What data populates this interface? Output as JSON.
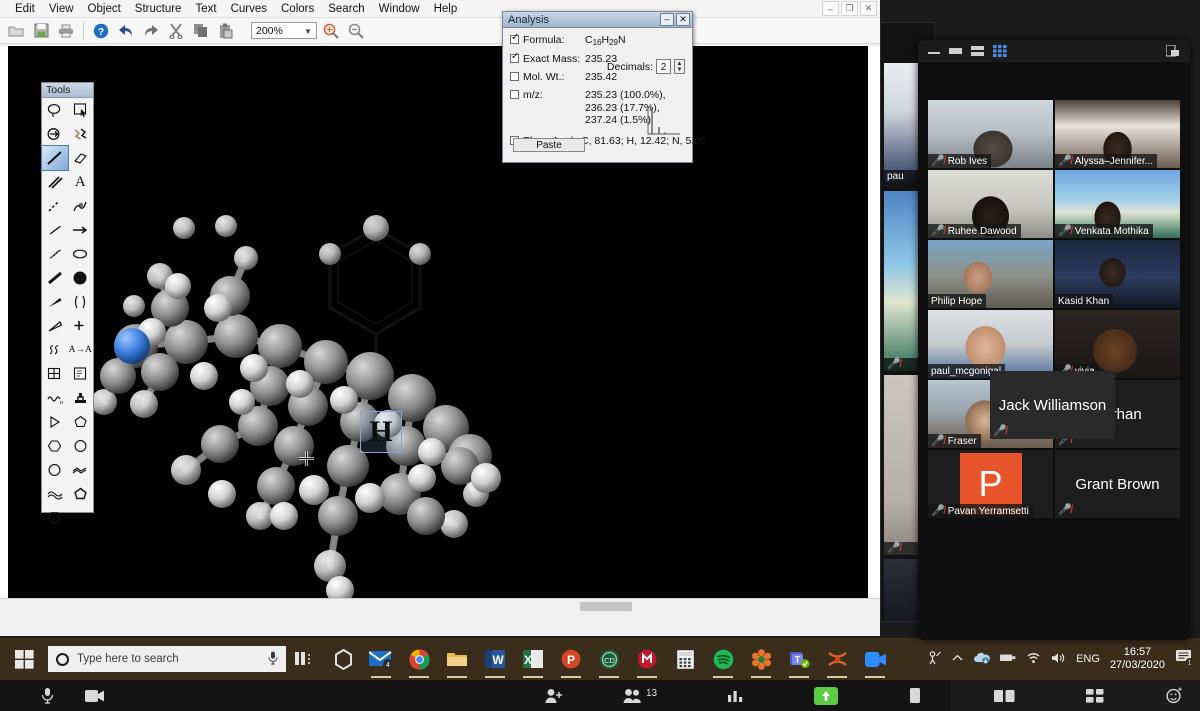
{
  "chemdraw": {
    "menus": [
      "Edit",
      "View",
      "Object",
      "Structure",
      "Text",
      "Curves",
      "Colors",
      "Search",
      "Window",
      "Help"
    ],
    "window_controls": [
      "–",
      "❐",
      "✕"
    ],
    "toolbar": {
      "zoom_value": "200%",
      "buttons": [
        {
          "name": "open-icon",
          "glyph": "▱"
        },
        {
          "name": "save-icon",
          "glyph": "▤"
        },
        {
          "name": "print-icon",
          "glyph": "🖶"
        },
        {
          "name": "help-icon",
          "glyph": "?"
        },
        {
          "name": "undo-icon",
          "glyph": "↰"
        },
        {
          "name": "redo-icon",
          "glyph": "↱"
        },
        {
          "name": "cut-icon",
          "glyph": "✂"
        },
        {
          "name": "copy-icon",
          "glyph": "❐"
        },
        {
          "name": "paste-icon",
          "glyph": "📋"
        }
      ],
      "zoom_in": "⊕",
      "zoom_out": "⊖"
    },
    "tools_palette": {
      "title": "Tools",
      "items": [
        {
          "name": "lasso-tool",
          "glyph": "◯"
        },
        {
          "name": "marquee-select-tool",
          "glyph": "⬔"
        },
        {
          "name": "eraser-pointer-tool",
          "glyph": "⊕"
        },
        {
          "name": "chain-tool",
          "glyph": "⌁"
        },
        {
          "name": "solid-bond-tool",
          "glyph": "╱",
          "selected": true
        },
        {
          "name": "eraser-tool",
          "glyph": "▱"
        },
        {
          "name": "multiple-bond-tool",
          "glyph": "⫽"
        },
        {
          "name": "text-tool",
          "glyph": "A"
        },
        {
          "name": "dashed-bond-tool",
          "glyph": "⁄"
        },
        {
          "name": "pen-tool",
          "glyph": "✎"
        },
        {
          "name": "hashed-bond-tool",
          "glyph": "⫼"
        },
        {
          "name": "arrow-tool",
          "glyph": "→"
        },
        {
          "name": "hashed-wedge-tool",
          "glyph": "⫼"
        },
        {
          "name": "orbital-tool",
          "glyph": "⬭"
        },
        {
          "name": "bold-bond-tool",
          "glyph": "╲"
        },
        {
          "name": "filled-circle-tool",
          "glyph": "●"
        },
        {
          "name": "wedge-bond-tool",
          "glyph": "◣"
        },
        {
          "name": "bracket-tool",
          "glyph": "()"
        },
        {
          "name": "hollow-wedge-tool",
          "glyph": "◺"
        },
        {
          "name": "plus-tool",
          "glyph": "+"
        },
        {
          "name": "squiggle-bond-tool",
          "glyph": "ʓ"
        },
        {
          "name": "atom-label-tool",
          "glyph": "A→A"
        },
        {
          "name": "table-tool",
          "glyph": "⊞"
        },
        {
          "name": "template-tool",
          "glyph": "🗒"
        },
        {
          "name": "polymer-bracket-tool",
          "glyph": "∿"
        },
        {
          "name": "stamp-tool",
          "glyph": "⌷"
        },
        {
          "name": "triangle-tool",
          "glyph": "▷"
        },
        {
          "name": "cyclopentane-tool",
          "glyph": "⬠"
        },
        {
          "name": "cyclohexane-tool",
          "glyph": "⬡"
        },
        {
          "name": "cyclopentane-ring-tool",
          "glyph": "○"
        },
        {
          "name": "cyclohexane-ring-tool",
          "glyph": "⬡"
        },
        {
          "name": "chair-tool",
          "glyph": "∽"
        },
        {
          "name": "chair-alt-tool",
          "glyph": "≈"
        },
        {
          "name": "cyclopentane-filled-tool",
          "glyph": "⬟"
        },
        {
          "name": "cyclohexane-filled-tool",
          "glyph": "⬢"
        }
      ]
    },
    "selected_atom_label": "H"
  },
  "analysis_dialog": {
    "title": "Analysis",
    "minimize": "–",
    "close": "✕",
    "rows": [
      {
        "name": "formula",
        "checked": true,
        "label": "Formula:",
        "value_html": "C16H29N",
        "value": "C16H29N"
      },
      {
        "name": "exact-mass",
        "checked": true,
        "label": "Exact Mass:",
        "value": "235.23"
      },
      {
        "name": "mol-weight",
        "checked": false,
        "label": "Mol. Wt.:",
        "value": "235.42"
      },
      {
        "name": "mz",
        "checked": false,
        "label": "m/z:",
        "value": "235.23 (100.0%), 236.23 (17.7%), 237.24 (1.5%)"
      },
      {
        "name": "elem-anal",
        "checked": false,
        "label": "Elem. Anal.:",
        "value": "C, 81.63; H, 12.42; N, 5.95"
      }
    ],
    "mz_lines": [
      "235.23 (100.0%),",
      "236.23 (17.7%),",
      "237.24 (1.5%)"
    ],
    "decimals_label": "Decimals:",
    "decimals_value": "2",
    "paste_label": "Paste"
  },
  "zoom_meeting": {
    "toolbar_icons": [
      {
        "name": "minimize-icon",
        "glyph": "—"
      },
      {
        "name": "maximize-icon",
        "glyph": "▬"
      },
      {
        "name": "speaker-view-icon",
        "glyph": "▤"
      },
      {
        "name": "gallery-view-icon",
        "glyph": "▦"
      }
    ],
    "fullscreen_icon": "⛶",
    "participants": [
      {
        "name": "Rob Ives",
        "muted": true,
        "video": true,
        "avatar": null,
        "photo": "p-rob",
        "active": false
      },
      {
        "name": "Alyssa–Jennifer...",
        "muted": true,
        "video": true,
        "photo": "p-alys",
        "active": false
      },
      {
        "name": "Ruhee Dawood",
        "muted": true,
        "video": true,
        "photo": "p-ruhee",
        "active": false
      },
      {
        "name": "Venkata Mothika",
        "muted": true,
        "video": true,
        "photo": "p-venk",
        "active": false
      },
      {
        "name": "Philip Hope",
        "muted": false,
        "video": true,
        "photo": "p-phil",
        "active": false
      },
      {
        "name": "Kasid Khan",
        "muted": false,
        "video": true,
        "photo": "p-kasid",
        "active": false
      },
      {
        "name": "paul_mcgonigal",
        "muted": false,
        "video": true,
        "photo": "p-paul",
        "active": true
      },
      {
        "name": "vivia",
        "muted": true,
        "video": true,
        "photo": "p-vivia",
        "active": false
      },
      {
        "name": "Fraser",
        "muted": true,
        "video": true,
        "photo": "p-fras",
        "active": false
      },
      {
        "name": "Burhan",
        "muted": true,
        "video": false,
        "photo": null,
        "active": false
      },
      {
        "name": "Pavan Yerramsetti",
        "muted": true,
        "video": false,
        "avatar": "P",
        "active": false
      },
      {
        "name": "Grant Brown",
        "muted": true,
        "video": false,
        "photo": null,
        "active": false
      },
      {
        "name": "Jack Williamson",
        "muted": true,
        "video": false,
        "photo": null,
        "active": false
      }
    ],
    "background_window_names": [
      "pau",
      "",
      ""
    ],
    "control_bar": {
      "participant_count": "13",
      "items": [
        {
          "name": "mute-control",
          "glyph": "🎤"
        },
        {
          "name": "video-control",
          "glyph": "📹"
        },
        {
          "name": "invite-control",
          "glyph": "👤+"
        },
        {
          "name": "participants-control",
          "glyph": "👥",
          "badge": "13"
        },
        {
          "name": "polls-control",
          "glyph": "📊"
        },
        {
          "name": "share-screen-control",
          "glyph": "⬆"
        },
        {
          "name": "chat-control",
          "glyph": "▯"
        },
        {
          "name": "record-control",
          "glyph": "⏺"
        },
        {
          "name": "breakout-rooms-control",
          "glyph": "⊞"
        },
        {
          "name": "reactions-control",
          "glyph": "☺"
        }
      ]
    }
  },
  "taskbar": {
    "search_placeholder": "Type here to search",
    "search_icon": "search-circle-icon",
    "mic_icon": "microphone-icon",
    "apps": [
      {
        "name": "task-view-icon",
        "glyph": "❏"
      },
      {
        "name": "cortana-icon",
        "glyph": "⬡"
      },
      {
        "name": "mail-icon",
        "glyph": "✉",
        "badge": "4"
      },
      {
        "name": "chrome-icon",
        "glyph": "◉"
      },
      {
        "name": "file-explorer-icon",
        "glyph": "🗀"
      },
      {
        "name": "word-icon",
        "glyph": "W"
      },
      {
        "name": "excel-icon",
        "glyph": "X"
      },
      {
        "name": "powerpoint-icon",
        "glyph": "P"
      },
      {
        "name": "chemdraw-icon",
        "glyph": "CD"
      },
      {
        "name": "mendeley-icon",
        "glyph": "M"
      },
      {
        "name": "calculator-icon",
        "glyph": "▦"
      },
      {
        "name": "spotify-icon",
        "glyph": "♬"
      },
      {
        "name": "photos-icon",
        "glyph": "❀"
      },
      {
        "name": "teams-icon",
        "glyph": "T"
      },
      {
        "name": "endnote-icon",
        "glyph": "✖"
      },
      {
        "name": "zoom-icon",
        "glyph": "▶"
      }
    ],
    "tray": {
      "pen_icon": "ꭤ",
      "chevron_icon": "⌃",
      "onedrive_icon": "☁",
      "hardware_icon": "▭",
      "wifi_icon": "◗",
      "volume_icon": "🔊",
      "language": "ENG",
      "time": "16:57",
      "date": "27/03/2020",
      "notification_badge": "1"
    }
  }
}
